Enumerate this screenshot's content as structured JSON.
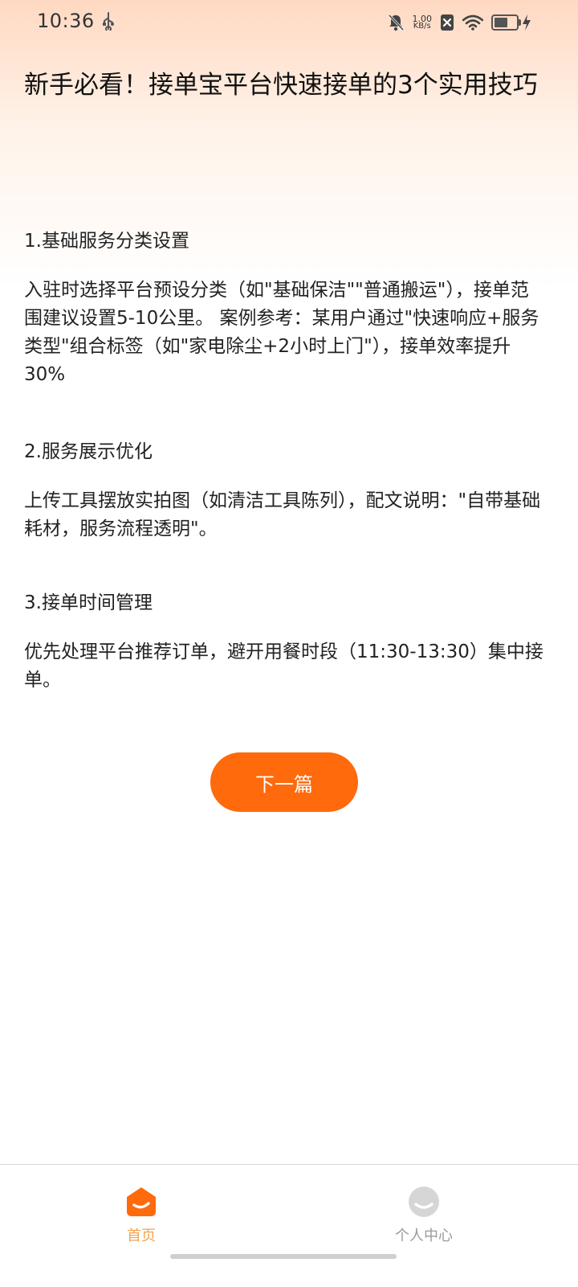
{
  "status_bar": {
    "time": "10:36",
    "net_speed_value": "1.00",
    "net_speed_unit": "KB/s",
    "battery_level": 0.64,
    "icons": [
      "usb-icon",
      "bell-off-icon",
      "no-sim-icon",
      "wifi-icon",
      "battery-icon",
      "charging-icon"
    ]
  },
  "article": {
    "title": "新手必看！接单宝平台快速接单的3个实用技巧",
    "sections": [
      {
        "heading": "1.基础服务分类设置",
        "body": "入驻时选择平台预设分类（如\"基础保洁\"\"普通搬运\"），接单范围建议设置5-10公里。 案例参考：某用户通过\"快速响应+服务类型\"组合标签（如\"家电除尘+2小时上门\"），接单效率提升30%"
      },
      {
        "heading": "2.服务展示优化",
        "body": "上传工具摆放实拍图（如清洁工具陈列），配文说明：\"自带基础耗材，服务流程透明\"。"
      },
      {
        "heading": "3.接单时间管理",
        "body": "优先处理平台推荐订单，避开用餐时段（11:30-13:30）集中接单。"
      }
    ]
  },
  "next_button": {
    "label": "下一篇"
  },
  "bottom_nav": {
    "tabs": [
      {
        "label": "首页",
        "icon": "home-icon",
        "active": true
      },
      {
        "label": "个人中心",
        "icon": "profile-icon",
        "active": false
      }
    ]
  },
  "colors": {
    "accent": "#ff6a0c",
    "active_tab": "#f4a34d",
    "inactive_tab": "#9a9a9a"
  }
}
